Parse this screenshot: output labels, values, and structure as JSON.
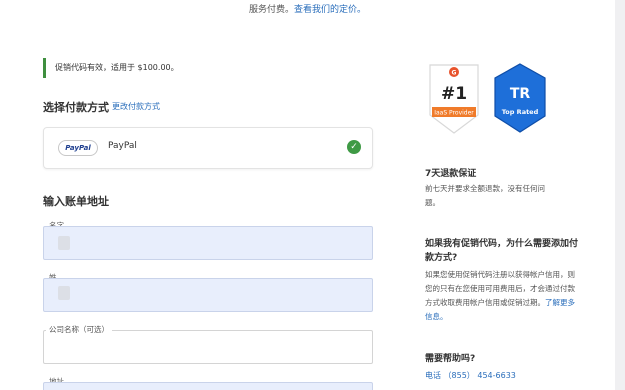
{
  "top_notice": {
    "text": "服务付费。",
    "link": "查看我们的定价。"
  },
  "promo": {
    "text": "促销代码有效，适用于 $100.00。"
  },
  "payment": {
    "title": "选择付款方式",
    "change_link": "更改付款方式",
    "method_badge": "PayPal",
    "method_label": "PayPal",
    "selected_icon": "check-circle-icon"
  },
  "billing": {
    "title": "输入账单地址",
    "fields": [
      {
        "label": "名字",
        "value": ""
      },
      {
        "label": "姓",
        "value": ""
      },
      {
        "label": "公司名称（可选）",
        "value": ""
      },
      {
        "label": "地址",
        "value": ""
      }
    ]
  },
  "badges": {
    "g2": {
      "rank": "#1",
      "caption": "IaaS Provider"
    },
    "trustradius": {
      "logo": "TR",
      "caption": "Top Rated"
    }
  },
  "sidebar": {
    "refund_title": "7天退款保证",
    "refund_text": "前七天并要求全额退款，没有任何问题。",
    "promo_q_title": "如果我有促销代码，为什么需要添加付款方式?",
    "promo_q_text": "如果您使用促销代码注册以获得帐户信用，则您的只有在您使用可用费用后，才会通过付款方式收取费用帐户信用或促销过期。",
    "promo_q_link": "了解更多信息。",
    "help_title": "需要帮助吗?",
    "phone": "电话 （855） 454-6633"
  },
  "colors": {
    "link": "#2a6ebb",
    "success": "#3f9a45",
    "promo_bar": "#3f8f3f",
    "field_fill": "#e8eefc",
    "tr_badge": "#1e6fd9"
  }
}
